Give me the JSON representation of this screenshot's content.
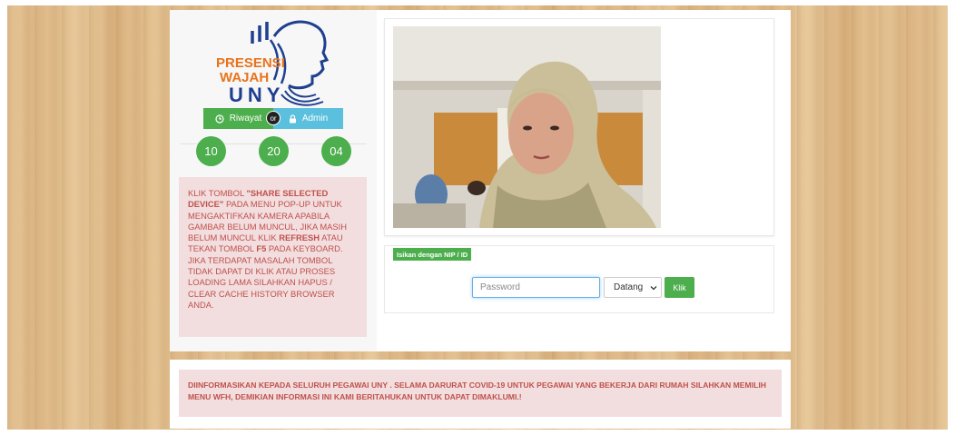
{
  "logo": {
    "line1": "PRESENSI",
    "line2": "WAJAH",
    "line3": "UNY",
    "orange": "#e8731c",
    "blue": "#1f3f8f"
  },
  "buttons": {
    "riwayat": "Riwayat",
    "or": "or",
    "admin": "Admin",
    "klik": "Klik"
  },
  "clock": {
    "hours": "10",
    "minutes": "20",
    "seconds": "04"
  },
  "notice_left": {
    "p1": "KLIK TOMBOL ",
    "b1": "\"SHARE SELECTED DEVICE\"",
    "p2": " PADA MENU POP-UP UNTUK MENGAKTIFKAN KAMERA APABILA GAMBAR BELUM MUNCUL, JIKA MASIH BELUM MUNCUL KLIK ",
    "b2": "REFRESH",
    "p3": " ATAU TEKAN TOMBOL ",
    "b3": "F5",
    "p4": " PADA KEYBOARD. JIKA TERDAPAT MASALAH TOMBOL TIDAK DAPAT DI KLIK ATAU PROSES LOADING LAMA SILAHKAN HAPUS / CLEAR CACHE HISTORY BROWSER ANDA."
  },
  "form": {
    "nip_label": "Isikan dengan NIP / ID",
    "password_placeholder": "Password",
    "select_value": "Datang"
  },
  "notice_bottom": "DIINFORMASIKAN KEPADA SELURUH PEGAWAI UNY . SELAMA DARURAT COVID-19 UNTUK PEGAWAI YANG BEKERJA DARI RUMAH SILAHKAN MEMILIH MENU WFH, DEMIKIAN INFORMASI INI KAMI BERITAHUKAN UNTUK DAPAT DIMAKLUMI.!",
  "colors": {
    "green": "#4cae4c",
    "info": "#5bc0de",
    "alert_bg": "#f2dede",
    "alert_text": "#c0504d"
  },
  "icons": {
    "riwayat": "clock-icon",
    "admin": "lock-icon",
    "select": "chevron-down-icon"
  }
}
